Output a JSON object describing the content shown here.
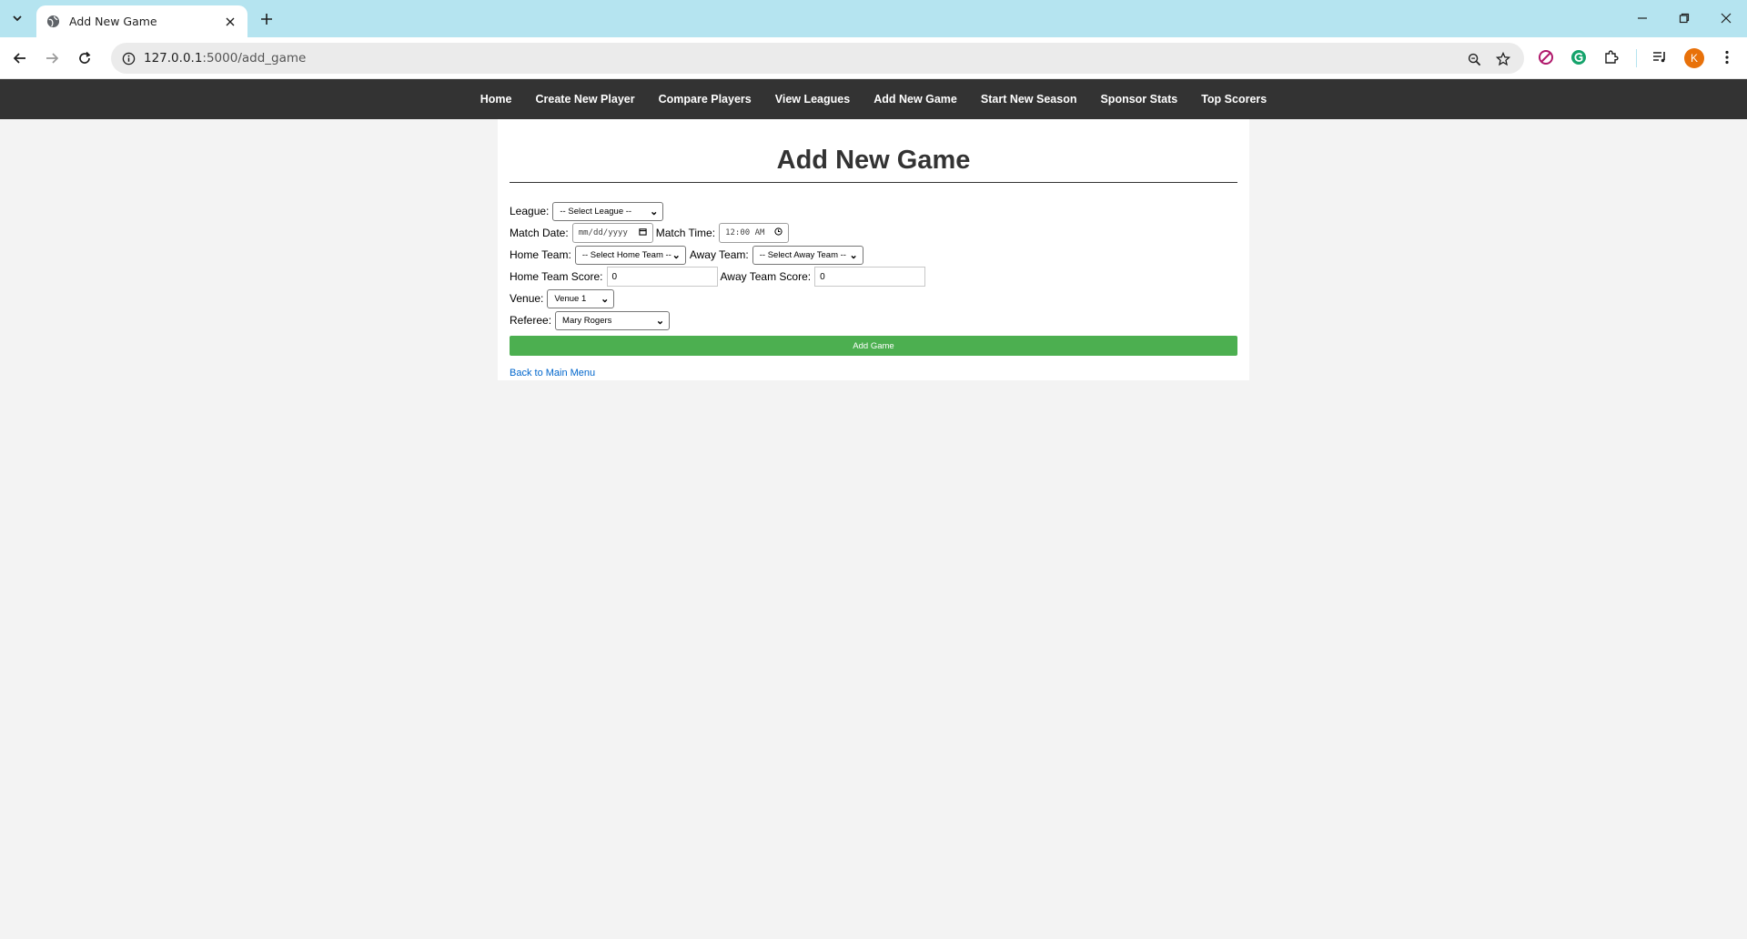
{
  "browser": {
    "tab_title": "Add New Game",
    "url_host": "127.0.0.1",
    "url_path": ":5000/add_game",
    "avatar_letter": "K"
  },
  "nav": {
    "items": [
      "Home",
      "Create New Player",
      "Compare Players",
      "View Leagues",
      "Add New Game",
      "Start New Season",
      "Sponsor Stats",
      "Top Scorers"
    ]
  },
  "page": {
    "title": "Add New Game"
  },
  "form": {
    "league_label": "League:",
    "league_value": "-- Select League --",
    "match_date_label": "Match Date:",
    "match_date_value": "mm/dd/yyyy",
    "match_time_label": "Match Time:",
    "match_time_value": "12:00 AM",
    "home_team_label": "Home Team:",
    "home_team_value": "-- Select Home Team --",
    "away_team_label": "Away Team:",
    "away_team_value": "-- Select Away Team --",
    "home_score_label": "Home Team Score:",
    "home_score_value": "0",
    "away_score_label": "Away Team Score:",
    "away_score_value": "0",
    "venue_label": "Venue:",
    "venue_value": "Venue 1",
    "referee_label": "Referee:",
    "referee_value": "Mary Rogers",
    "submit_label": "Add Game",
    "back_link": "Back to Main Menu"
  },
  "colors": {
    "nav_bg": "#333333",
    "submit_bg": "#4caf50",
    "link": "#0066cc",
    "tabbar": "#b5e4f0"
  }
}
